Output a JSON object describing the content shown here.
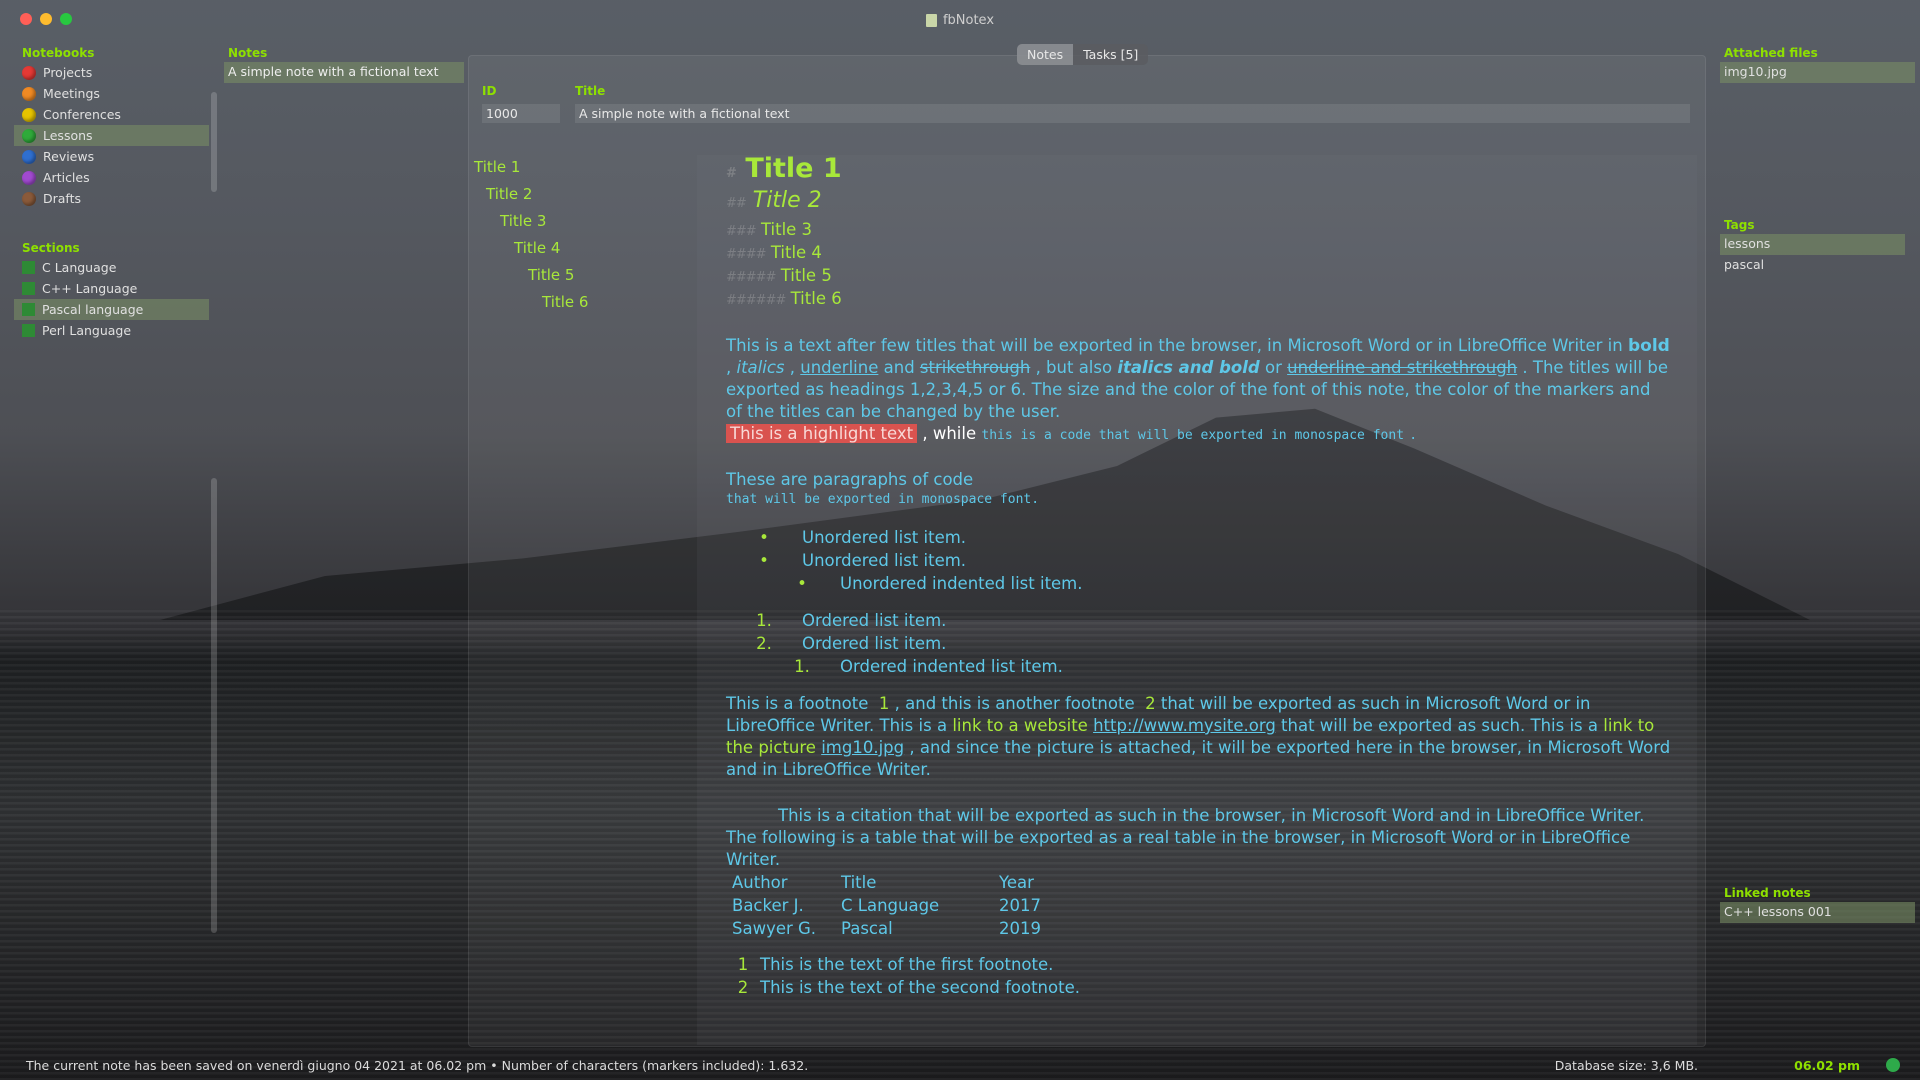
{
  "app": {
    "title": "fbNotex"
  },
  "sidebar": {
    "notebooks_header": "Notebooks",
    "notebooks": [
      {
        "label": "Projects",
        "color": "#e53935"
      },
      {
        "label": "Meetings",
        "color": "#f08a24"
      },
      {
        "label": "Conferences",
        "color": "#e6c300"
      },
      {
        "label": "Lessons",
        "color": "#2faa3a",
        "selected": true
      },
      {
        "label": "Reviews",
        "color": "#2f6fd0"
      },
      {
        "label": "Articles",
        "color": "#a14ad0"
      },
      {
        "label": "Drafts",
        "color": "#8a5a3a"
      }
    ],
    "sections_header": "Sections",
    "sections": [
      {
        "label": "C Language"
      },
      {
        "label": "C++ Language"
      },
      {
        "label": "Pascal language",
        "selected": true
      },
      {
        "label": "Perl Language"
      }
    ]
  },
  "notes": {
    "header": "Notes",
    "items": [
      "A simple note with a fictional text"
    ]
  },
  "tabs": [
    {
      "label": "Notes",
      "active": true
    },
    {
      "label": "Tasks [5]"
    }
  ],
  "fields": {
    "id_label": "ID",
    "id_value": "1000",
    "title_label": "Title",
    "title_value": "A simple note with a fictional text"
  },
  "outline": [
    "Title 1",
    "Title 2",
    "Title 3",
    "Title 4",
    "Title 5",
    "Title 6"
  ],
  "note": {
    "markers": [
      "#",
      "##",
      "###",
      "####",
      "#####",
      "######"
    ],
    "titles": [
      "Title 1",
      "Title 2",
      "Title 3",
      "Title 4",
      "Title 5",
      "Title 6"
    ],
    "p1": {
      "a": "This is a text after few titles that will be exported in the browser, in Microsoft Word or in LibreOffice Writer in",
      "bold": "bold",
      "italics": "italics",
      "underline": "underline",
      "and": "and",
      "strikethrough": "strikethrough",
      "butalso": ", but also",
      "italicsbold": "italics and bold",
      "or": "or",
      "undstrike": "underline and strikethrough",
      "rest": ". The titles will be exported as headings 1,2,3,4,5 or 6. The size and the color of the font of this note, the color of the markers and of the titles can be changed by the user.",
      "highlight": "This is a highlight text",
      "while": ", while",
      "code": "this is a code that will be exported in monospace font",
      "dot": "."
    },
    "code_para": {
      "line1": "These are paragraphs of code",
      "line2": "that will be exported in monospace font."
    },
    "ulist": [
      "Unordered list item.",
      "Unordered list item.",
      "Unordered indented list item."
    ],
    "olist": [
      {
        "n": "1.",
        "text": "Ordered list item."
      },
      {
        "n": "2.",
        "text": "Ordered list item."
      },
      {
        "n": "1.",
        "text": "Ordered indented list item."
      }
    ],
    "p2": {
      "a": "This is a footnote",
      "fn1": "1",
      "b": ", and this is another footnote",
      "fn2": "2",
      "c": "that will be exported as such in Microsoft Word or in LibreOffice Writer. This is a",
      "link1": "link to a website",
      "url": "http://www.mysite.org",
      "d": "that will be exported as such. This is a",
      "link2": "link to the picture",
      "img": "img10.jpg",
      "e": ", and since the picture is attached, it will be exported here in the browser, in Microsoft Word and in LibreOffice Writer."
    },
    "citation": "This is a citation that will be exported as such in the browser, in Microsoft Word and in LibreOffice Writer.",
    "table_intro": "The following is a table that will be exported as a real table in the browser, in Microsoft Word or in LibreOffice Writer.",
    "table": {
      "headers": [
        "Author",
        "Title",
        "Year"
      ],
      "rows": [
        [
          "Backer J.",
          "C Language",
          "2017"
        ],
        [
          "Sawyer G.",
          "Pascal",
          "2019"
        ]
      ]
    },
    "footnotes": [
      {
        "n": "1",
        "text": "This is the text of the first footnote."
      },
      {
        "n": "2",
        "text": "This is the text of the second footnote."
      }
    ]
  },
  "right": {
    "attached_header": "Attached files",
    "attached": [
      "img10.jpg"
    ],
    "tags_header": "Tags",
    "tags": [
      "lessons",
      "pascal"
    ],
    "linked_header": "Linked notes",
    "linked": [
      "C++ lessons 001"
    ]
  },
  "status": {
    "saved": "The current note has been saved on venerdì giugno 04 2021 at 06.02 pm  •  Number of characters (markers included): 1.632.",
    "db": "Database size: 3,6 MB.",
    "time": "06.02 pm"
  }
}
